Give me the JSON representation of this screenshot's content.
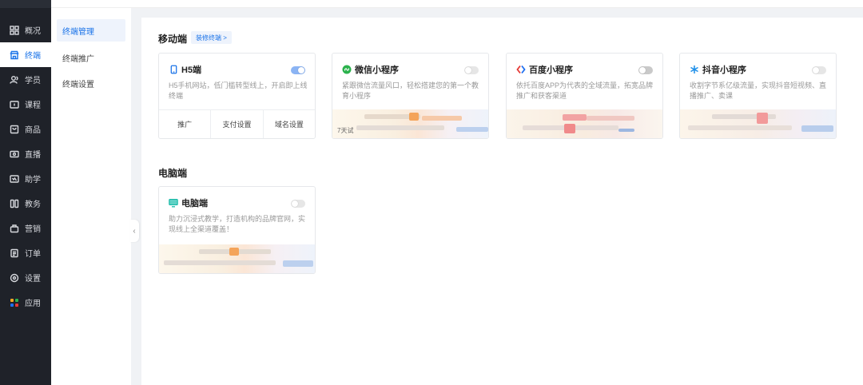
{
  "nav": {
    "items": [
      {
        "label": "概况",
        "icon": "grid-icon"
      },
      {
        "label": "终端",
        "icon": "store-icon"
      },
      {
        "label": "学员",
        "icon": "users-icon"
      },
      {
        "label": "课程",
        "icon": "course-icon"
      },
      {
        "label": "商品",
        "icon": "goods-icon"
      },
      {
        "label": "直播",
        "icon": "live-icon"
      },
      {
        "label": "助学",
        "icon": "study-icon"
      },
      {
        "label": "教务",
        "icon": "academic-icon"
      },
      {
        "label": "营销",
        "icon": "marketing-icon"
      },
      {
        "label": "订单",
        "icon": "order-icon"
      },
      {
        "label": "设置",
        "icon": "settings-icon"
      },
      {
        "label": "应用",
        "icon": "apps-icon"
      }
    ],
    "active_index": 1
  },
  "submenu": {
    "items": [
      "终端管理",
      "终端推广",
      "终端设置"
    ],
    "active_index": 0
  },
  "main": {
    "mobile_section": {
      "title": "移动端",
      "link_label": "装修终端 >"
    },
    "desktop_section": {
      "title": "电脑端"
    },
    "cards": {
      "h5": {
        "title": "H5端",
        "desc": "H5手机网站，低门槛转型线上，开启即上线终端",
        "toggle_on": true,
        "actions": [
          "推广",
          "支付设置",
          "域名设置"
        ]
      },
      "wechat": {
        "title": "微信小程序",
        "desc": "紧跟微信流量风口，轻松搭建您的第一个教育小程序",
        "toggle_on": false,
        "note": "7天试"
      },
      "baidu": {
        "title": "百度小程序",
        "desc": "依托百度APP为代表的全域流量，拓宽品牌推广和获客渠道",
        "toggle_on": false
      },
      "douyin": {
        "title": "抖音小程序",
        "desc": "收割字节系亿级流量，实现抖音短视频、直播推广、卖课",
        "toggle_on": false
      },
      "pc": {
        "title": "电脑端",
        "desc": "助力沉浸式教学，打造机构的品牌官网，实现线上全渠道覆盖！",
        "toggle_on": false
      }
    }
  },
  "colors": {
    "accent": "#1a73e8",
    "nav_bg": "#1f2229",
    "wechat": "#2bb24c",
    "baidu_red": "#e53935",
    "baidu_blue": "#1e6ff0",
    "douyin": "#1a8de8",
    "pc": "#14b8a6"
  }
}
